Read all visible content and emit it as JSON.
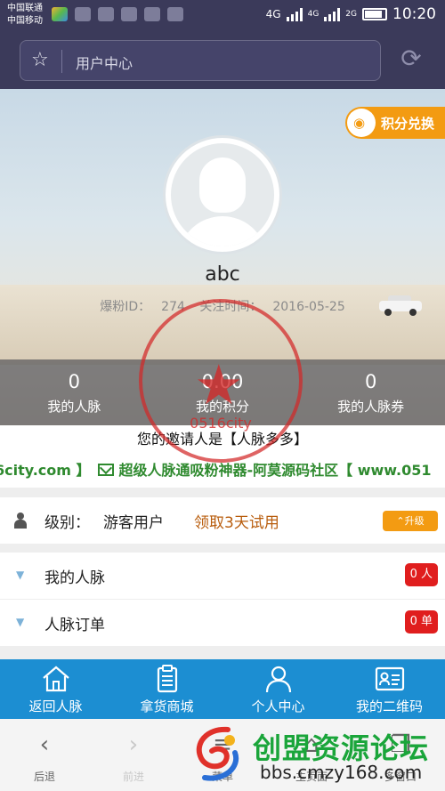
{
  "status_bar": {
    "carrier_1": "中国联通",
    "carrier_2": "中国移动",
    "network": "4G",
    "sim1": "4G",
    "sim2": "2G",
    "time": "10:20"
  },
  "browser": {
    "url_text": "用户中心",
    "icons": [
      "star-icon",
      "refresh-icon"
    ]
  },
  "profile": {
    "exchange_label": "积分兑换",
    "username": "abc",
    "fan_id_label": "爆粉ID：",
    "fan_id": "274",
    "follow_time_label": "关注时间：",
    "follow_time": "2016-05-25"
  },
  "stats": [
    {
      "value": "0",
      "label": "我的人脉"
    },
    {
      "value": "0.00",
      "label": "我的积分"
    },
    {
      "value": "0",
      "label": "我的人脉券"
    }
  ],
  "invite": {
    "text": "您的邀请人是【人脉多多】"
  },
  "marquee": {
    "before": "6city.com 】",
    "text": "超级人脉通吸粉神器-阿莫源码社区【 www.051"
  },
  "level": {
    "label": "级别：",
    "value": "游客用户",
    "trial_link": "领取3天试用",
    "upgrade_button": "⌃升级"
  },
  "menu": [
    {
      "label": "我的人脉",
      "badge": "0 人"
    },
    {
      "label": "人脉订单",
      "badge": "0 单"
    }
  ],
  "app_nav": [
    {
      "label": "返回人脉",
      "icon": "home-icon"
    },
    {
      "label": "拿货商城",
      "icon": "clipboard-icon"
    },
    {
      "label": "个人中心",
      "icon": "user-icon"
    },
    {
      "label": "我的二维码",
      "icon": "id-card-icon"
    }
  ],
  "browser_toolbar": [
    {
      "label": "后退",
      "icon": "‹"
    },
    {
      "label": "前进",
      "icon": "›"
    },
    {
      "label": "菜单",
      "icon": "≡"
    },
    {
      "label": "主页面",
      "icon": "⌂"
    },
    {
      "label": "多窗口",
      "icon": "❐"
    }
  ],
  "watermarks": {
    "seal_text": "0516city",
    "brand_main": "创盟资源论坛",
    "brand_url": "bbs.cmzy168.com"
  },
  "colors": {
    "status_bar": "#3b3a5a",
    "exchange_orange": "#f39b12",
    "nav_blue": "#1c8ed2",
    "badge_red": "#e01e1e",
    "marquee_green": "#2f8a2f"
  }
}
